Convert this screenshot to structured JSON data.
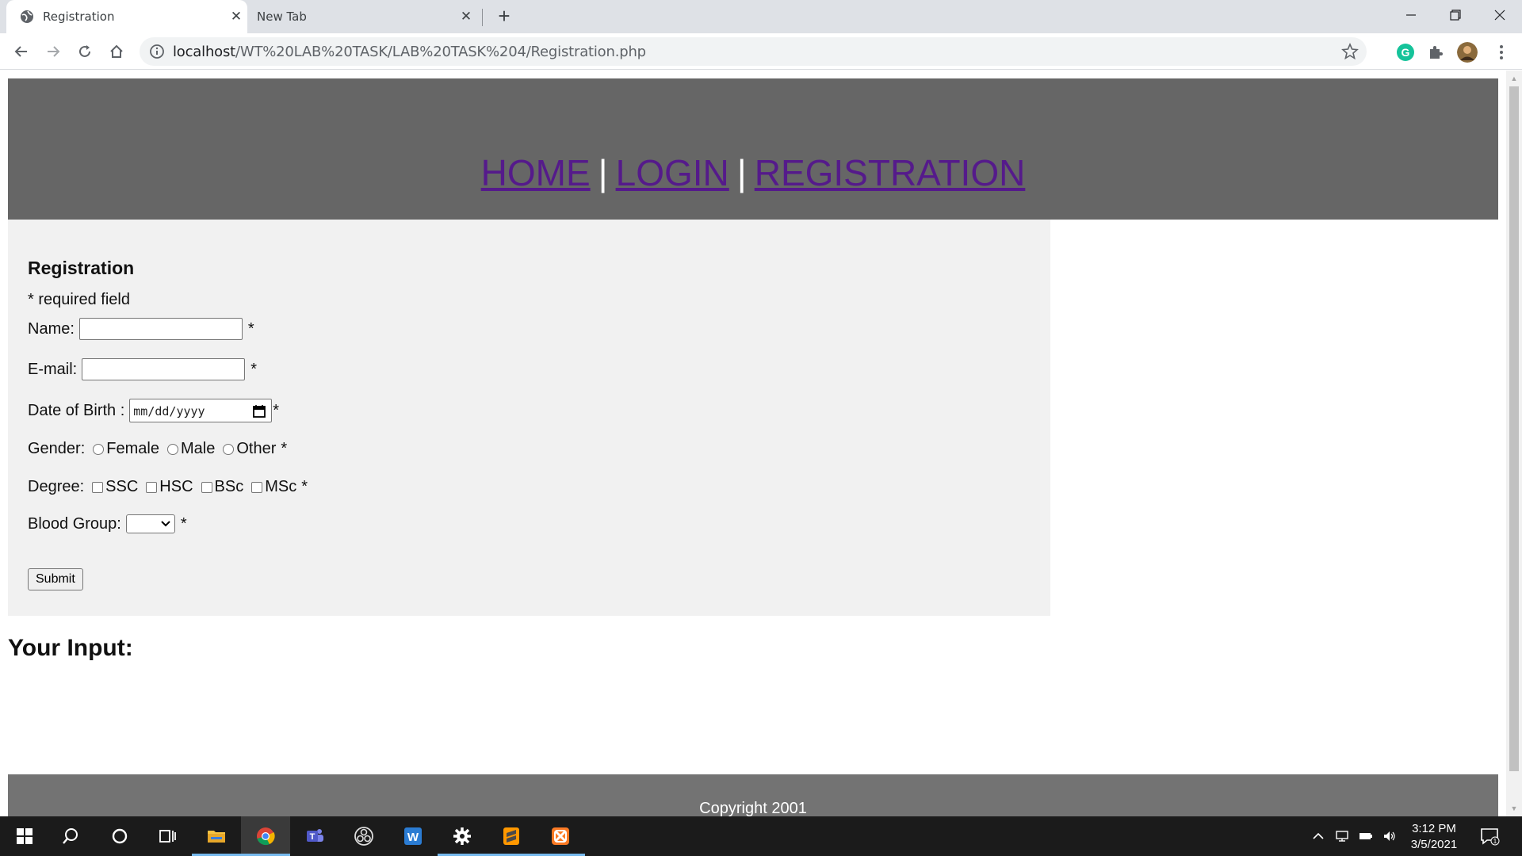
{
  "browser": {
    "tabs": [
      {
        "title": "Registration",
        "active": true
      },
      {
        "title": "New Tab",
        "active": false
      }
    ],
    "url": "localhost/WT%20LAB%20TASK/LAB%20TASK%204/Registration.php",
    "url_host": "localhost",
    "url_path": "/WT%20LAB%20TASK/LAB%20TASK%204/Registration.php"
  },
  "nav": {
    "home": "HOME",
    "login": "LOGIN",
    "registration": "REGISTRATION",
    "separator": "|"
  },
  "form": {
    "heading": "Registration",
    "required_note": "* required field",
    "name_label": "Name:",
    "email_label": "E-mail:",
    "dob_label": "Date of Birth :",
    "dob_placeholder": "mm/dd/yyyy",
    "gender_label": "Gender:",
    "gender_options": [
      "Female",
      "Male",
      "Other"
    ],
    "degree_label": "Degree:",
    "degree_options": [
      "SSC",
      "HSC",
      "BSc",
      "MSc"
    ],
    "blood_label": "Blood Group:",
    "blood_value": "",
    "required_mark": "*",
    "submit_label": "Submit"
  },
  "result": {
    "heading": "Your Input:"
  },
  "footer": {
    "copyright": "Copyright 2001"
  },
  "taskbar": {
    "time": "3:12 PM",
    "date": "3/5/2021",
    "notification_count": "1"
  },
  "colors": {
    "header_bg": "#666666",
    "panel_bg": "#f1f1f1",
    "footer_bg": "#737373",
    "link_visited": "#551a8b"
  }
}
